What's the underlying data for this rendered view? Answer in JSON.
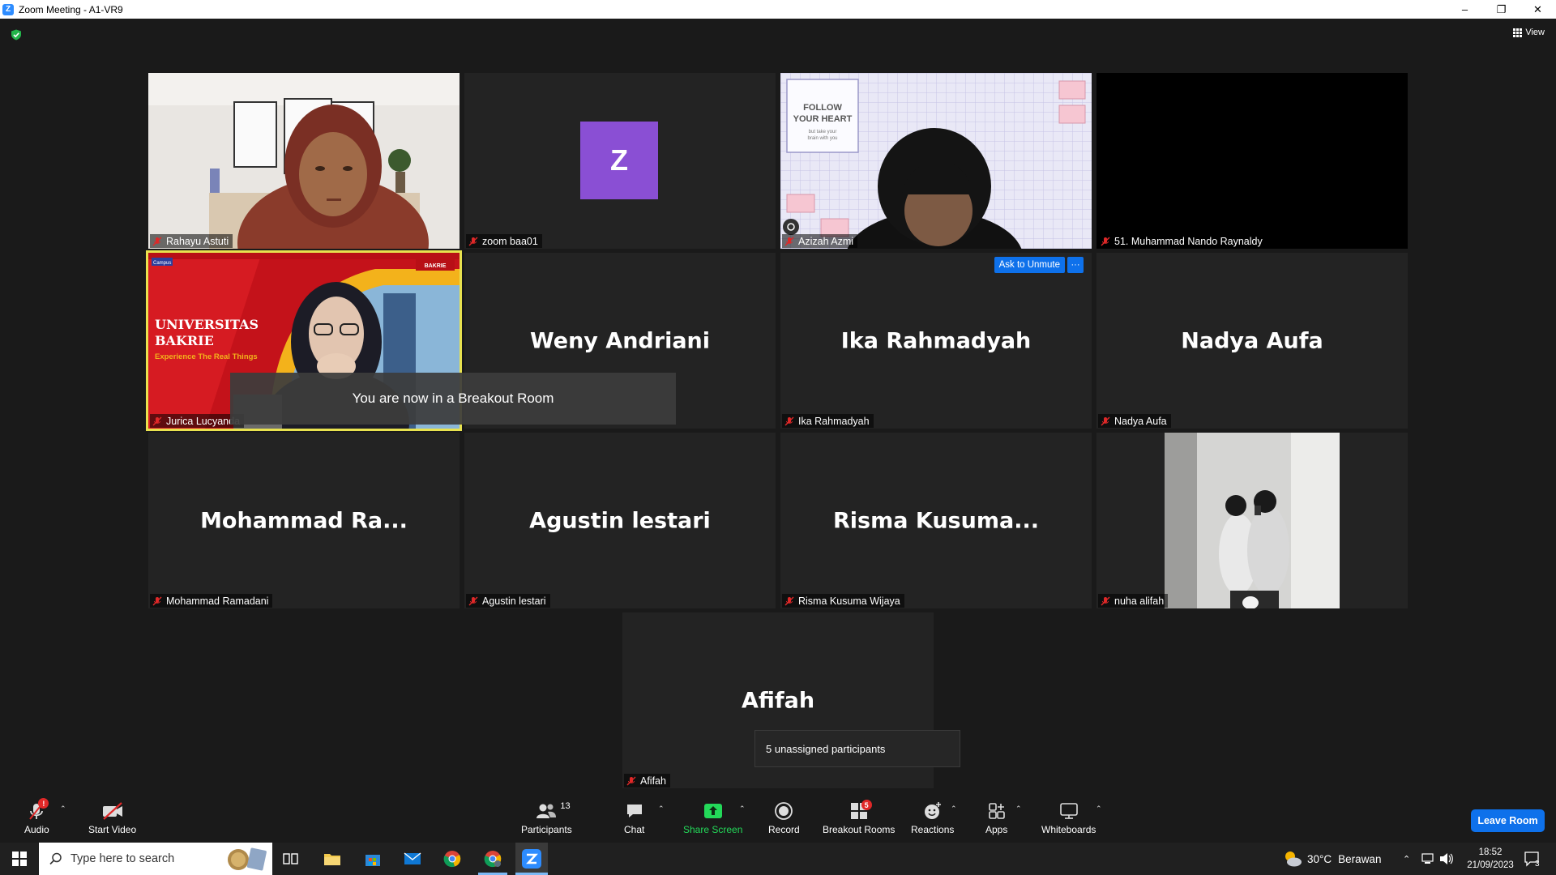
{
  "window": {
    "title": "Zoom Meeting - A1-VR9",
    "minimize": "–",
    "maximize": "❐",
    "close": "✕"
  },
  "header": {
    "view_label": "View"
  },
  "tiles": [
    {
      "name": "Rahayu Astuti",
      "type": "video"
    },
    {
      "name": "zoom baa01",
      "type": "avatar",
      "avatar_letter": "Z",
      "avatar_color": "#8a4fd4"
    },
    {
      "name": "Azizah Azmi",
      "type": "video"
    },
    {
      "name": "51. Muhammad Nando Raynaldy",
      "type": "blank"
    },
    {
      "name": "Jurica Lucyanda",
      "type": "video",
      "active_speaker": true
    },
    {
      "name": "Weny Andriani",
      "display_name": "Weny Andriani",
      "type": "name"
    },
    {
      "name": "Ika Rahmadyah",
      "display_name": "Ika Rahmadyah",
      "type": "name"
    },
    {
      "name": "Nadya Aufa",
      "display_name": "Nadya Aufa",
      "type": "name"
    },
    {
      "name": "Mohammad Ramadani",
      "display_name": "Mohammad  Ra...",
      "type": "name"
    },
    {
      "name": "Agustin lestari",
      "display_name": "Agustin lestari",
      "type": "name"
    },
    {
      "name": "Risma Kusuma Wijaya",
      "display_name": "Risma  Kusuma...",
      "type": "name"
    },
    {
      "name": "nuha alifah",
      "type": "video"
    },
    {
      "name": "Afifah",
      "display_name": "Afifah",
      "type": "name"
    }
  ],
  "slide": {
    "line1": "UNIVERSITAS",
    "line2": "BAKRIE",
    "tagline": "Experience The Real Things",
    "logo_text": "BAKRIE",
    "corner_text": "Campus"
  },
  "poster": {
    "line1": "FOLLOW",
    "line2": "YOUR HEART",
    "line3": "but take your",
    "line4": "brain with you"
  },
  "ask_to_unmute": "Ask to Unmute",
  "more_dots": "···",
  "toast": "You are now in a Breakout Room",
  "tooltip": "5 unassigned participants",
  "toolbar": {
    "audio": "Audio",
    "start_video": "Start Video",
    "participants": "Participants",
    "participants_count": "13",
    "chat": "Chat",
    "share_screen": "Share Screen",
    "record": "Record",
    "breakout_rooms": "Breakout Rooms",
    "breakout_badge": "5",
    "reactions": "Reactions",
    "apps": "Apps",
    "whiteboards": "Whiteboards",
    "leave": "Leave Room",
    "audio_badge": "!"
  },
  "taskbar": {
    "search_placeholder": "Type here to search",
    "weather_temp": "30°C",
    "weather_text": "Berawan",
    "time": "18:52",
    "date": "21/09/2023",
    "notification_count": "3"
  },
  "colors": {
    "accent_blue": "#0e71eb",
    "active_speaker": "#e8e24f",
    "share_green": "#23d959",
    "mute_red": "#e02828"
  }
}
